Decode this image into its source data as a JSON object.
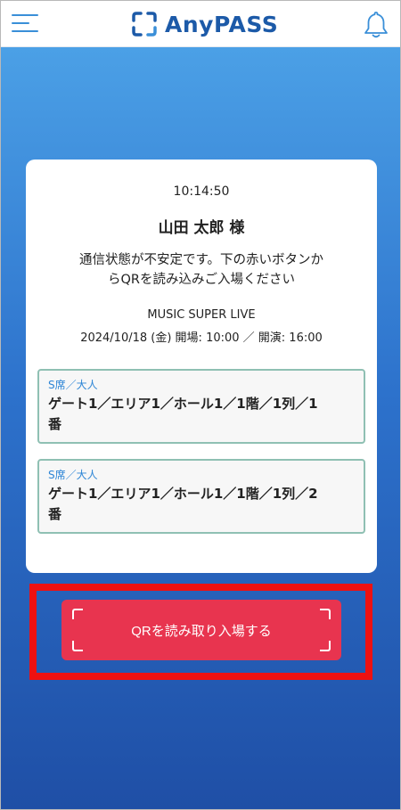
{
  "header": {
    "logo_text": "AnyPASS",
    "logo_color": "#1c5aa8",
    "menu_icon": "hamburger-menu-icon",
    "notification_icon": "bell-icon"
  },
  "card": {
    "time": "10:14:50",
    "user_name": "山田 太郎 様",
    "notice_line1": "通信状態が不安定です。下の赤いボタンか",
    "notice_line2": "らQRを読み込みご入場ください",
    "event_name": "MUSIC SUPER LIVE",
    "event_datetime": "2024/10/18 (金) 開場: 10:00 ／ 開演: 16:00"
  },
  "tickets": [
    {
      "type": "S席／大人",
      "seat_line1": "ゲート1／エリア1／ホール1／1階／1列／1",
      "seat_line2": "番"
    },
    {
      "type": "S席／大人",
      "seat_line1": "ゲート1／エリア1／ホール1／1階／1列／2",
      "seat_line2": "番"
    }
  ],
  "action": {
    "qr_button_label": "QRを読み取り入場する",
    "button_color": "#e8344f",
    "highlight_color": "#ee1111"
  }
}
